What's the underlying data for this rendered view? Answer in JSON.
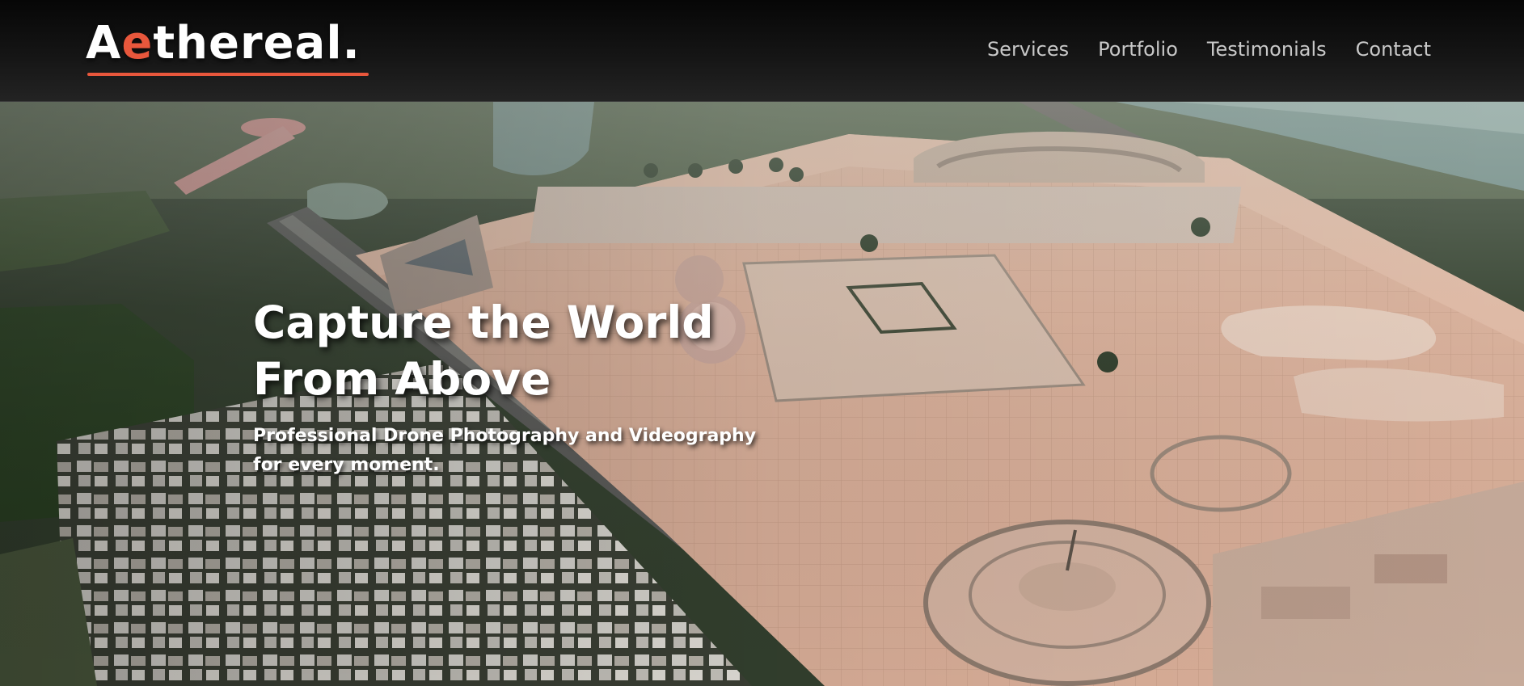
{
  "brand": {
    "logo_first": "A",
    "logo_accent": "e",
    "logo_rest": "thereal.",
    "accent_color": "#e8573c"
  },
  "nav": {
    "items": [
      {
        "label": "Services"
      },
      {
        "label": "Portfolio"
      },
      {
        "label": "Testimonials"
      },
      {
        "label": "Contact"
      }
    ]
  },
  "hero": {
    "title_line1": "Capture the World",
    "title_line2": "From Above",
    "subtitle_line1": "Professional Drone Photography and Videography",
    "subtitle_line2": "for every moment."
  }
}
